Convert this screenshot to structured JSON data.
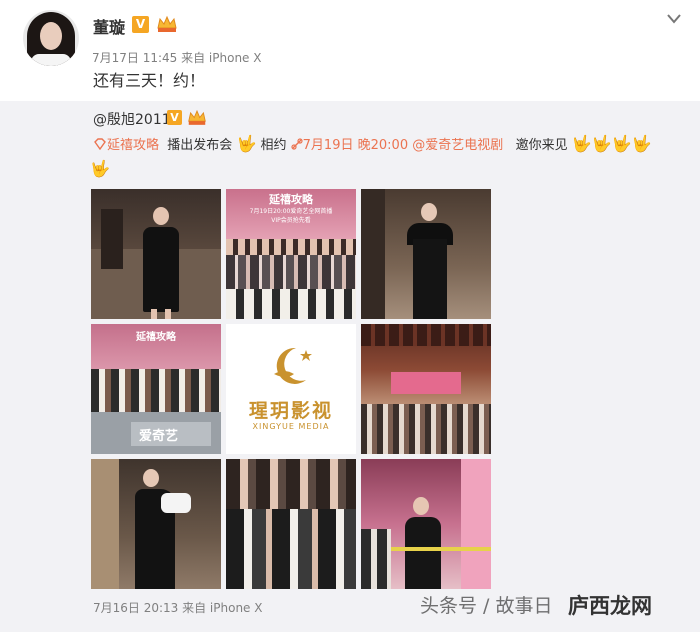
{
  "post": {
    "author": "董璇",
    "verified_badge": "V",
    "timestamp": "7月17日 11:45 来自 iPhone X",
    "text": "还有三天！约！"
  },
  "repost": {
    "author": "@殷旭2011",
    "verified_badge": "V",
    "link1": "延禧攻略",
    "text_a": "播出发布会",
    "text_b": "相约",
    "link2": "7月19日",
    "text_c": "晚20:00",
    "link3": "@爱奇艺电视剧",
    "text_d": "邀你来见",
    "hand_emoji": "🤟",
    "images": [
      {
        "alt": "photo-1"
      },
      {
        "alt": "photo-2",
        "banner_title": "延禧攻略",
        "banner_sub": "7月19日20:00爱奇艺全网首播",
        "banner_sub2": "VIP会员抢先看"
      },
      {
        "alt": "photo-3"
      },
      {
        "alt": "photo-4",
        "banner_title": "延禧攻略",
        "brand": "爱奇艺"
      },
      {
        "alt": "xingyue-logo",
        "logo_cn": "瑆玥影视",
        "logo_en": "XINGYUE MEDIA"
      },
      {
        "alt": "photo-6"
      },
      {
        "alt": "photo-7"
      },
      {
        "alt": "photo-8"
      },
      {
        "alt": "photo-9"
      }
    ],
    "timestamp": "7月16日 20:13 来自 iPhone X"
  },
  "watermark": {
    "text": "头条号 / 故事日",
    "site": "庐西龙网"
  },
  "colors": {
    "link": "#eb7350",
    "badge": "#f5a623",
    "repost_bg": "#f2f2f5"
  }
}
